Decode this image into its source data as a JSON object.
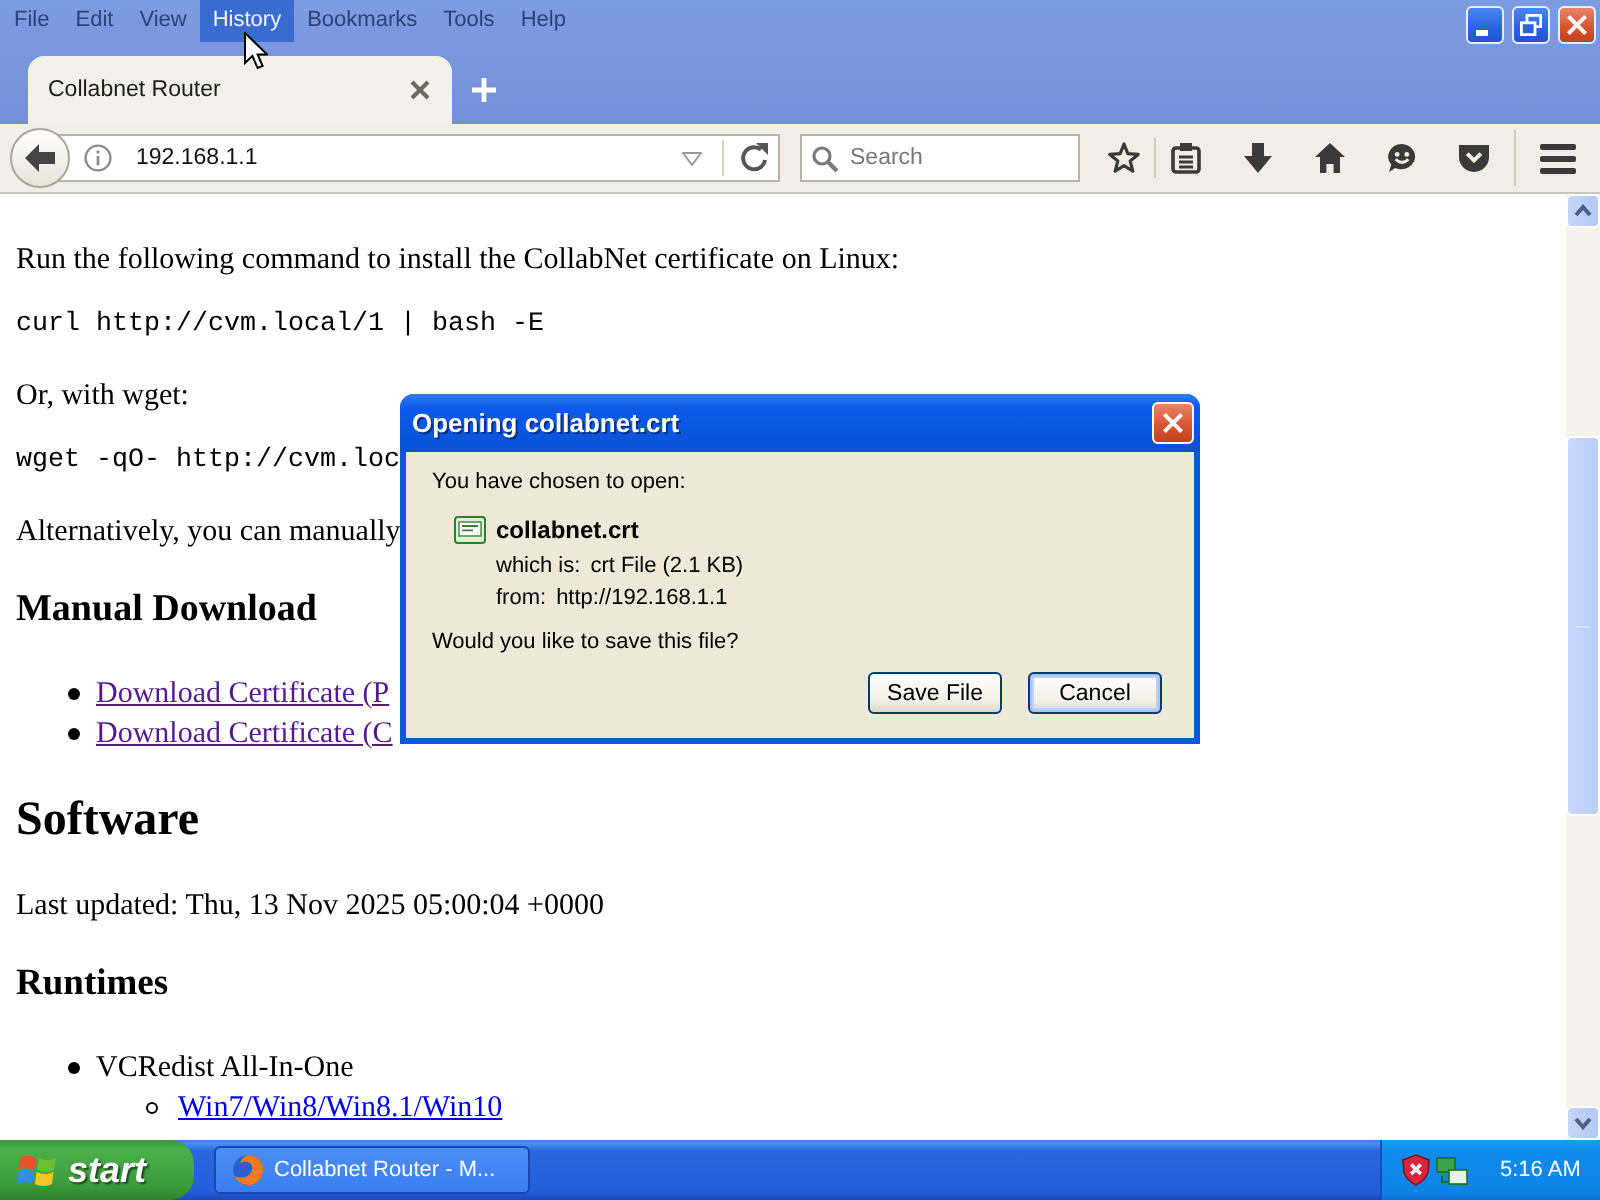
{
  "menu_bar": [
    {
      "label": "File",
      "selected": false
    },
    {
      "label": "Edit",
      "selected": false
    },
    {
      "label": "View",
      "selected": false
    },
    {
      "label": "History",
      "selected": true
    },
    {
      "label": "Bookmarks",
      "selected": false
    },
    {
      "label": "Tools",
      "selected": false
    },
    {
      "label": "Help",
      "selected": false
    }
  ],
  "tabs": [
    {
      "label": "Collabnet Router",
      "selected": true
    }
  ],
  "address_bar": {
    "value": "192.168.1.1"
  },
  "search": {
    "placeholder": "Search"
  },
  "page": {
    "blocks": [
      {
        "kind": "paragraph",
        "text": "Run the following command to install the CollabNet certificate on Linux:"
      },
      {
        "kind": "code",
        "text": "curl http://cvm.local/1 | bash -E"
      },
      {
        "kind": "paragraph",
        "text": "Or, with wget:"
      },
      {
        "kind": "code",
        "text": "wget -qO- http://cvm.loc"
      },
      {
        "kind": "paragraph",
        "text": "Alternatively, you can manually"
      },
      {
        "kind": "heading2",
        "text": "Manual Download"
      },
      {
        "kind": "list",
        "items": [
          {
            "kind": "link",
            "text": "Download Certificate (P",
            "visited": true
          },
          {
            "kind": "link",
            "text": "Download Certificate (C",
            "visited": true
          }
        ]
      },
      {
        "kind": "heading1",
        "text": "Software"
      },
      {
        "kind": "paragraph",
        "text": "Last updated: Thu, 13 Nov 2025 05:00:04 +0000"
      },
      {
        "kind": "heading3",
        "text": "Runtimes"
      },
      {
        "kind": "list",
        "items": [
          {
            "kind": "text",
            "text": "VCRedist All-In-One",
            "children": [
              {
                "kind": "link",
                "text": "Win7/Win8/Win8.1/Win10",
                "visited": false
              }
            ]
          }
        ]
      }
    ]
  },
  "dialog": {
    "title": "Opening collabnet.crt",
    "intro": "You have chosen to open:",
    "file_name": "collabnet.crt",
    "details": [
      {
        "label": "which is:",
        "value": "crt File (2.1 KB)"
      },
      {
        "label": "from:",
        "value": "http://192.168.1.1"
      }
    ],
    "question": "Would you like to save this file?",
    "buttons": [
      {
        "label": "Save File",
        "default": false
      },
      {
        "label": "Cancel",
        "default": true
      }
    ]
  },
  "taskbar": {
    "start_button": "start",
    "tasks": [
      {
        "label": "Collabnet Router - M...",
        "selected": false
      }
    ],
    "clock": "5:16 AM"
  }
}
